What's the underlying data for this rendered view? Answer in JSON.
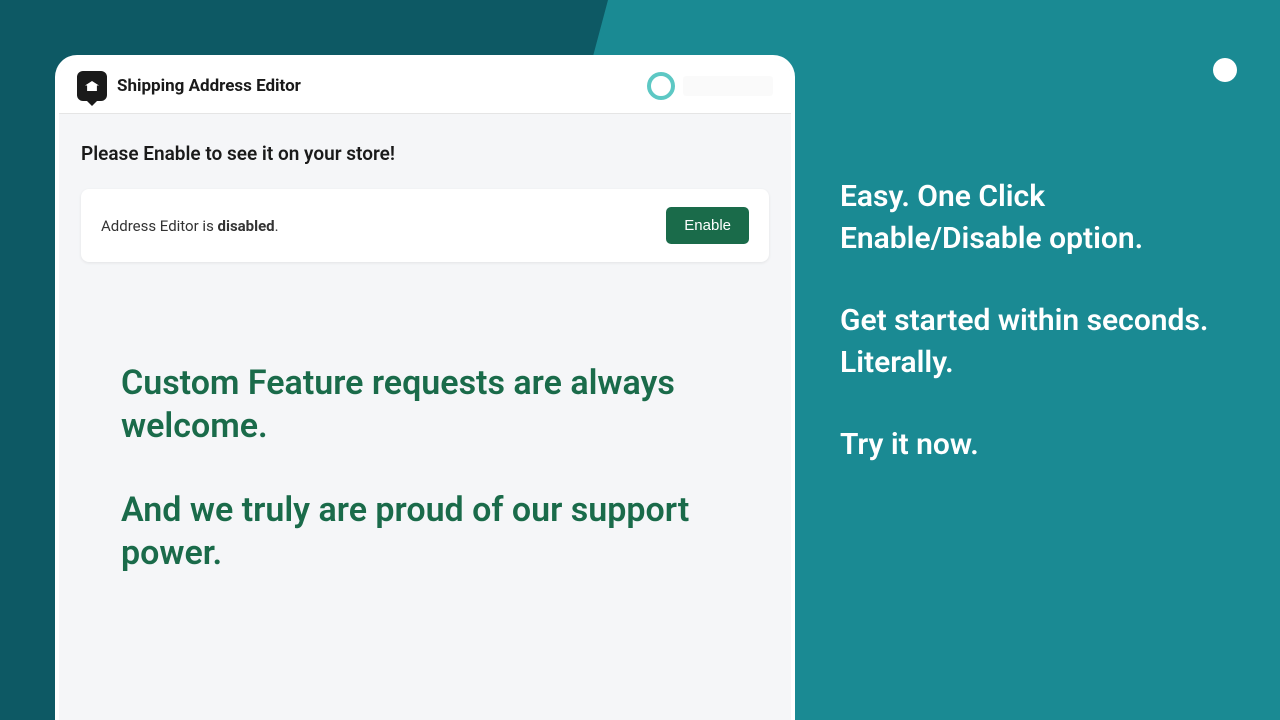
{
  "app": {
    "title": "Shipping Address Editor",
    "prompt": "Please Enable to see it on your store!",
    "status": {
      "prefix": "Address Editor is ",
      "state": "disabled",
      "suffix": "."
    },
    "enable_button": "Enable"
  },
  "promo": {
    "line1": "Custom Feature requests are always welcome.",
    "line2": "And we truly are proud of our support power."
  },
  "sidebar": {
    "line1": "Easy. One Click Enable/Disable option.",
    "line2": "Get started within seconds. Literally.",
    "line3": "Try it now."
  }
}
